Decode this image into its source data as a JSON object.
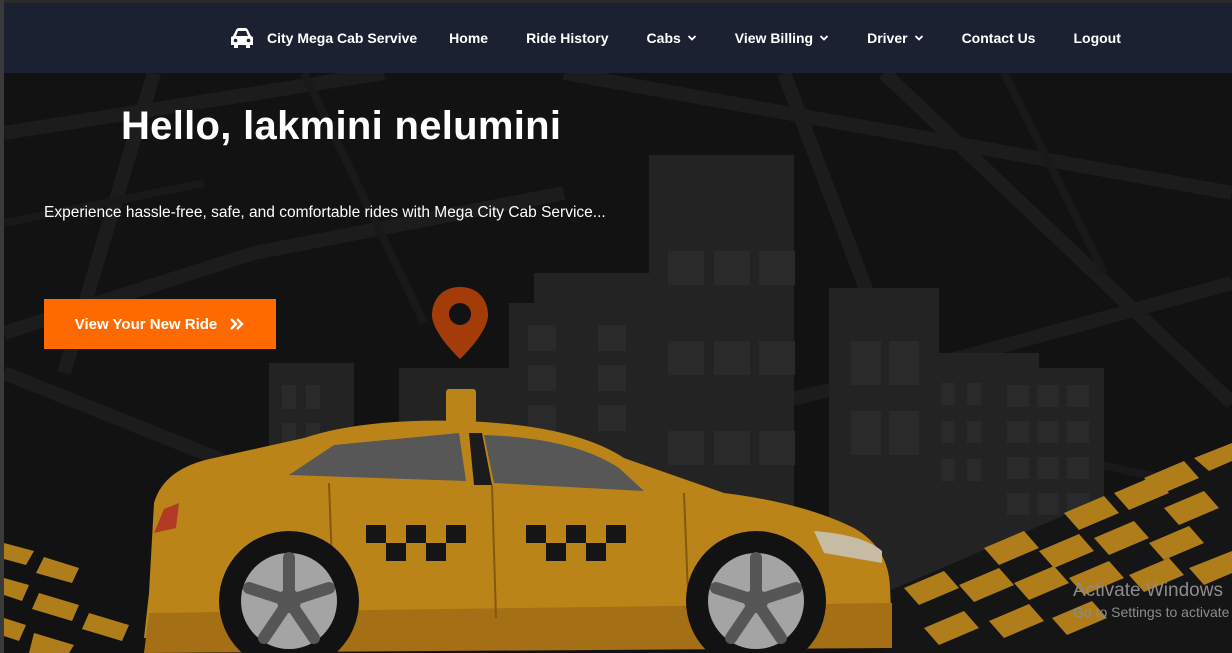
{
  "nav": {
    "brand": "City Mega Cab Servive",
    "brand_icon": "car-icon",
    "items": [
      {
        "label": "Home",
        "dropdown": false
      },
      {
        "label": "Ride History",
        "dropdown": false
      },
      {
        "label": "Cabs",
        "dropdown": true
      },
      {
        "label": "View Billing",
        "dropdown": true
      },
      {
        "label": "Driver",
        "dropdown": true
      },
      {
        "label": "Contact Us",
        "dropdown": false
      },
      {
        "label": "Logout",
        "dropdown": false
      }
    ]
  },
  "hero": {
    "greeting": "Hello, lakmini nelumini",
    "tagline": "Experience hassle-free, safe, and comfortable rides with Mega City Cab Service...",
    "cta_label": "View Your New Ride",
    "cta_icon": "double-chevron-right-icon"
  },
  "watermark": {
    "title": "Activate Windows",
    "subtitle": "Go to Settings to activate Windows."
  },
  "colors": {
    "navbar": "#1b2130",
    "accent": "#ff6a00",
    "taxi": "#e4a21e",
    "pin": "#c84a0c"
  }
}
